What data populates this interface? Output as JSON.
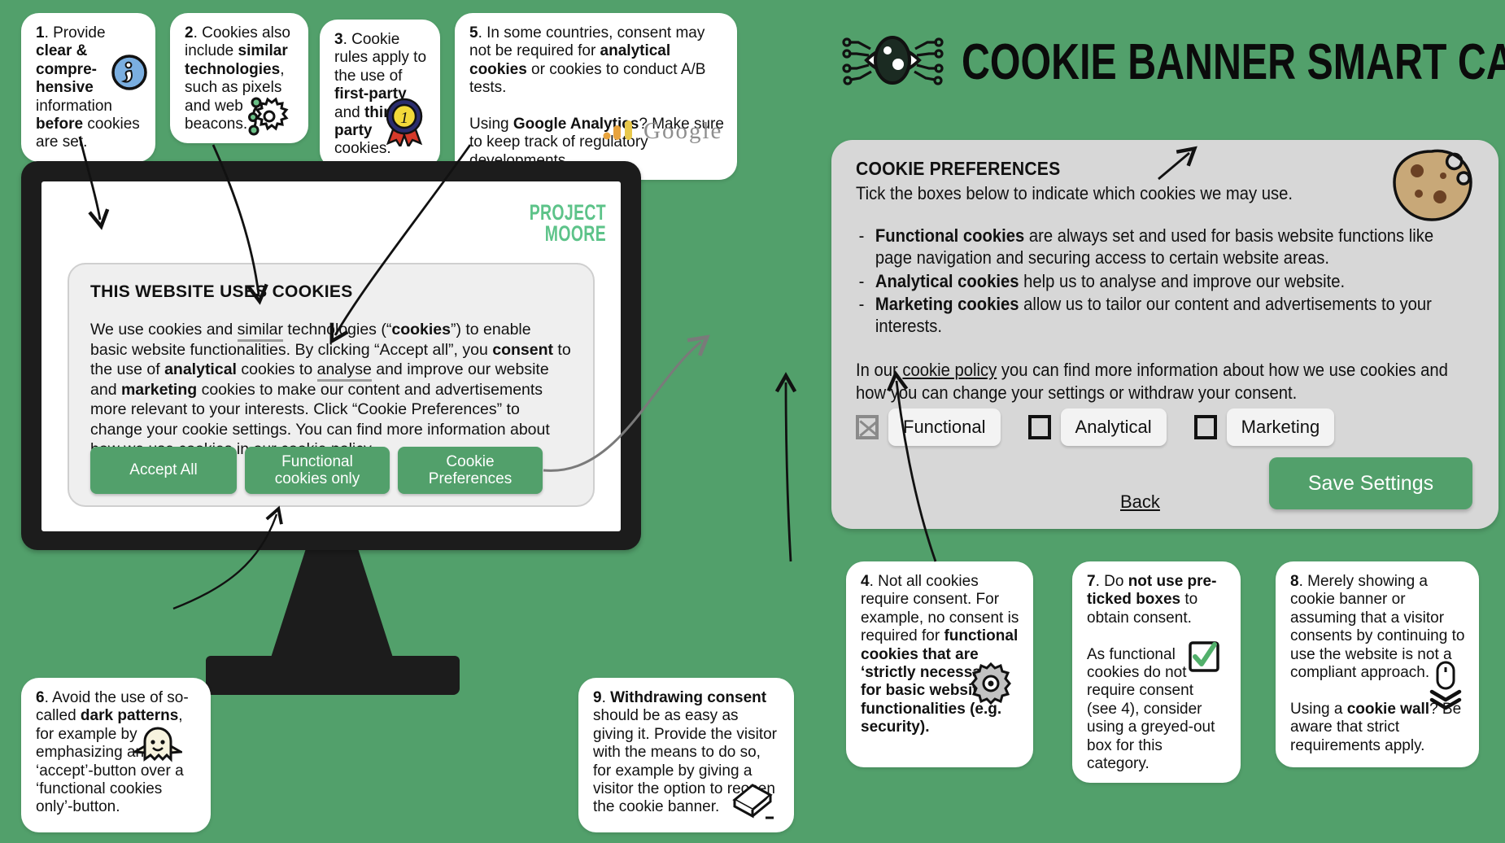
{
  "colors": {
    "background_green": "#52a06b",
    "button_green": "#52a06b",
    "logo_green": "#5dc389",
    "panel_grey": "#d7d7d7",
    "banner_grey": "#efefef",
    "monitor_black": "#1c1c1c"
  },
  "header": {
    "title": "COOKIE BANNER SMART CARD",
    "logo_icon": "cookie-eye-icon"
  },
  "screen": {
    "brand_line1": "PROJECT",
    "brand_line2": "MOORE"
  },
  "banner": {
    "heading": "THIS WEBSITE USES COOKIES",
    "body_parts": [
      {
        "t": "We use cookies and ",
        "style": "plain"
      },
      {
        "t": "similar",
        "style": "underline-grey"
      },
      {
        "t": " technologies (“",
        "style": "plain"
      },
      {
        "t": "cookies",
        "style": "bold"
      },
      {
        "t": "”) to enable basic website functionalities. By clicking “Accept all”, you ",
        "style": "plain"
      },
      {
        "t": "consent",
        "style": "bold"
      },
      {
        "t": " to the use of ",
        "style": "plain"
      },
      {
        "t": "analytical",
        "style": "bold"
      },
      {
        "t": " cookies to ",
        "style": "plain"
      },
      {
        "t": "analyse",
        "style": "underline-grey"
      },
      {
        "t": " and improve our website and ",
        "style": "plain"
      },
      {
        "t": "marketing",
        "style": "bold"
      },
      {
        "t": " cookies to make our content and advertisements more relevant to your interests. Click “Cookie Preferences” to change your cookie settings. You can find more information about how we use cookies in our ",
        "style": "plain"
      },
      {
        "t": "cookie policy",
        "style": "underline"
      },
      {
        "t": ".",
        "style": "plain"
      }
    ],
    "buttons": {
      "accept_all": "Accept All",
      "functional_only_line1": "Functional",
      "functional_only_line2": "cookies only",
      "preferences_line1": "Cookie",
      "preferences_line2": "Preferences"
    }
  },
  "prefs": {
    "heading": "COOKIE PREFERENCES",
    "subheading": "Tick the boxes below to indicate which cookies we may use.",
    "items": [
      {
        "bold": "Functional cookies",
        "rest": " are always set and used for basis website functions like page navigation and securing access to certain website areas."
      },
      {
        "bold": "Analytical cookies",
        "rest": " help us to analyse and improve our website."
      },
      {
        "bold": "Marketing cookies",
        "rest": " allow us to tailor our content and advertisements to your interests."
      }
    ],
    "policy_pre": "In our ",
    "policy_link": "cookie policy",
    "policy_post": " you can find more information about how we use cookies and how you can change your settings or withdraw your consent.",
    "checkboxes": [
      {
        "label": "Functional",
        "state": "checked-disabled",
        "icon": "checkbox-crossed-greyed-icon"
      },
      {
        "label": "Analytical",
        "state": "unchecked",
        "icon": "checkbox-empty-icon"
      },
      {
        "label": "Marketing",
        "state": "unchecked",
        "icon": "checkbox-empty-icon"
      }
    ],
    "back_label": "Back",
    "save_label": "Save Settings",
    "cookie_icon": "cookie-bitten-icon"
  },
  "cards": {
    "c1": {
      "number": "1",
      "parts": [
        {
          "t": ". Provide ",
          "style": "plain"
        },
        {
          "t": "clear & compre-hensive",
          "style": "bold"
        },
        {
          "t": " information ",
          "style": "plain"
        },
        {
          "t": "before",
          "style": "bold"
        },
        {
          "t": " cookies are set.",
          "style": "plain"
        }
      ],
      "icon": "info-circle-icon"
    },
    "c2": {
      "number": "2",
      "parts": [
        {
          "t": ". Cookies also include ",
          "style": "plain"
        },
        {
          "t": "similar technologies",
          "style": "bold"
        },
        {
          "t": ", such as pixels and web beacons.",
          "style": "plain"
        }
      ],
      "icon": "web-beacon-icon"
    },
    "c3": {
      "number": "3",
      "parts": [
        {
          "t": ". Cookie rules apply to the use of ",
          "style": "plain"
        },
        {
          "t": "first-party",
          "style": "bold"
        },
        {
          "t": " and ",
          "style": "plain"
        },
        {
          "t": "third-party",
          "style": "bold"
        },
        {
          "t": " cookies.",
          "style": "plain"
        }
      ],
      "icon": "first-place-ribbon-icon"
    },
    "c5": {
      "number": "5",
      "parts": [
        {
          "t": ". In some countries, consent may not be required for ",
          "style": "plain"
        },
        {
          "t": "analytical cookies",
          "style": "bold"
        },
        {
          "t": " or cookies to conduct A/B tests.",
          "style": "plain"
        },
        {
          "t": "\n",
          "style": "break"
        },
        {
          "t": "Using ",
          "style": "plain"
        },
        {
          "t": "Google Analytics",
          "style": "bold"
        },
        {
          "t": "? Make sure to keep track of regulatory developments.",
          "style": "plain"
        }
      ],
      "icon": "google-analytics-logo",
      "logo_text": "Google"
    },
    "c4": {
      "number": "4",
      "parts": [
        {
          "t": ". Not all cookies require consent. For example, no consent is required for ",
          "style": "plain"
        },
        {
          "t": "functional cookies that are ‘strictly necessary’ for basic website functionalities (e.g. security).",
          "style": "bold"
        }
      ],
      "icon": "gear-icon"
    },
    "c6": {
      "number": "6",
      "parts": [
        {
          "t": ". Avoid the use of so-called ",
          "style": "plain"
        },
        {
          "t": "dark patterns",
          "style": "bold"
        },
        {
          "t": ", for example by emphasizing an ‘accept’-button over a ‘functional cookies only’-button.",
          "style": "plain"
        }
      ],
      "icon": "ghost-icon"
    },
    "c7": {
      "number": "7",
      "parts": [
        {
          "t": ". Do ",
          "style": "plain"
        },
        {
          "t": "not use pre-ticked boxes",
          "style": "bold"
        },
        {
          "t": " to obtain consent.",
          "style": "plain"
        },
        {
          "t": "\n",
          "style": "break"
        },
        {
          "t": "As functional cookies do not require consent (see 4), consider using a greyed-out box for this category.",
          "style": "plain"
        }
      ],
      "icon": "checked-box-green-icon"
    },
    "c8": {
      "number": "8",
      "parts": [
        {
          "t": ". Merely showing a cookie banner or assuming that a visitor consents by continuing to use the website is not a compliant approach.",
          "style": "plain"
        },
        {
          "t": "\n",
          "style": "break"
        },
        {
          "t": "Using a ",
          "style": "plain"
        },
        {
          "t": "cookie wall",
          "style": "bold"
        },
        {
          "t": "? Be aware that strict requirements apply.",
          "style": "plain"
        }
      ],
      "icon": "scroll-mouse-icon"
    },
    "c9": {
      "number": "9",
      "parts": [
        {
          "t": ". ",
          "style": "plain"
        },
        {
          "t": "Withdrawing consent",
          "style": "bold"
        },
        {
          "t": " should be as easy as giving it. Provide the visitor with the means to do so, for example by giving a visitor the option to reopen the cookie banner.",
          "style": "plain"
        }
      ],
      "icon": "eraser-icon"
    }
  }
}
